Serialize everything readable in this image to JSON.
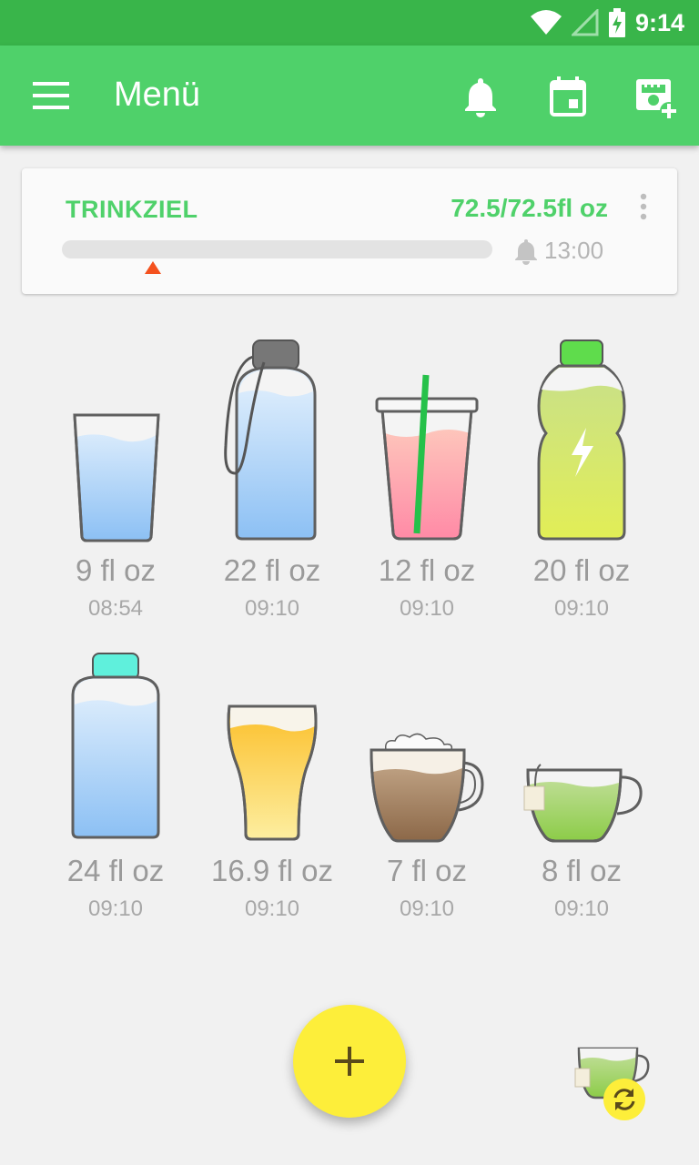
{
  "status_bar": {
    "time": "9:14"
  },
  "app_bar": {
    "title": "Menü",
    "icons": [
      "menu-icon",
      "bell-icon",
      "calendar-icon",
      "add-photo-icon"
    ]
  },
  "goal": {
    "label": "TRINKZIEL",
    "amount": "72.5/72.5fl oz",
    "progress_fraction": 0.0,
    "reminder_time": "13:00"
  },
  "drinks": [
    {
      "amount": "9 fl oz",
      "time": "08:54",
      "icon": "glass-of-water-icon"
    },
    {
      "amount": "22 fl oz",
      "time": "09:10",
      "icon": "water-bottle-icon"
    },
    {
      "amount": "12 fl oz",
      "time": "09:10",
      "icon": "cup-with-straw-icon"
    },
    {
      "amount": "20 fl oz",
      "time": "09:10",
      "icon": "sports-drink-bottle-icon"
    },
    {
      "amount": "24 fl oz",
      "time": "09:10",
      "icon": "large-water-bottle-icon"
    },
    {
      "amount": "16.9 fl oz",
      "time": "09:10",
      "icon": "beer-glass-icon"
    },
    {
      "amount": "7 fl oz",
      "time": "09:10",
      "icon": "coffee-cup-icon"
    },
    {
      "amount": "8 fl oz",
      "time": "09:10",
      "icon": "tea-cup-icon"
    }
  ],
  "colors": {
    "status_bar": "#39b54a",
    "app_bar": "#4fd16a",
    "accent_green": "#4fd16a",
    "fab": "#fdee3a",
    "marker": "#f4511e"
  }
}
